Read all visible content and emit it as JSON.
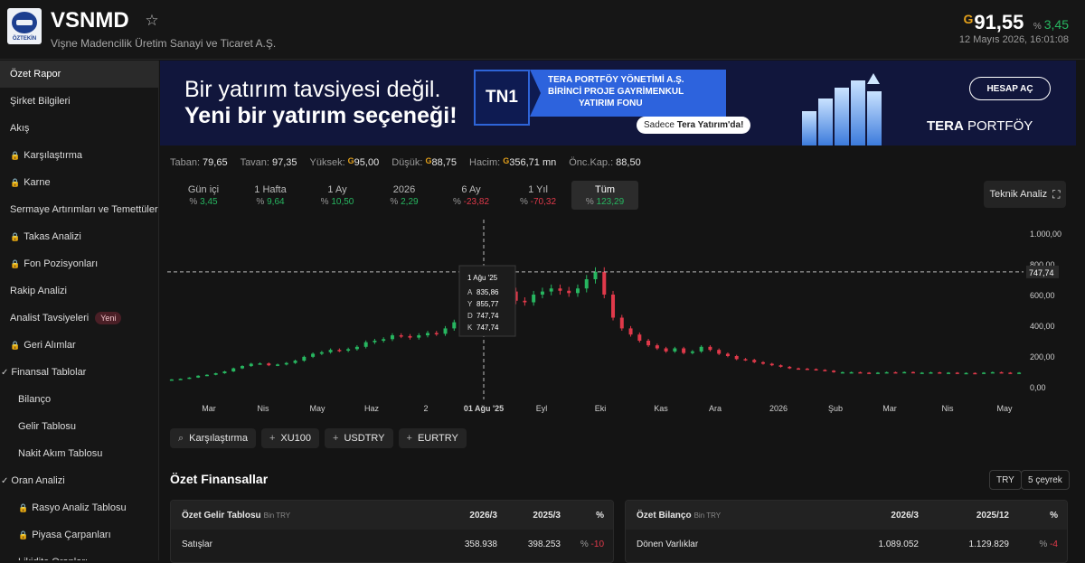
{
  "header": {
    "logo_text": "ÖZTEKİN",
    "ticker": "VSNMD",
    "company": "Vişne Madencilik Üretim Sanayi ve Ticaret A.Ş.",
    "currency_symbol": "G",
    "price": "91,55",
    "change_pct_symbol": "%",
    "change": "3,45",
    "timestamp": "12 Mayıs 2026, 16:01:08"
  },
  "sidebar": {
    "items": [
      {
        "label": "Özet Rapor",
        "lock": false,
        "active": true
      },
      {
        "label": "Şirket Bilgileri",
        "lock": false
      },
      {
        "label": "Akış",
        "lock": false
      },
      {
        "label": "Karşılaştırma",
        "lock": true
      },
      {
        "label": "Karne",
        "lock": true
      },
      {
        "label": "Sermaye Artırımları ve Temettüler",
        "lock": false
      },
      {
        "label": "Takas Analizi",
        "lock": true
      },
      {
        "label": "Fon Pozisyonları",
        "lock": true
      },
      {
        "label": "Rakip Analizi",
        "lock": false
      },
      {
        "label": "Analist Tavsiyeleri",
        "lock": false,
        "badge": "Yeni"
      },
      {
        "label": "Geri Alımlar",
        "lock": true
      },
      {
        "label": "Finansal Tablolar",
        "lock": false,
        "expanded": true
      },
      {
        "label": "Bilanço",
        "sub": true
      },
      {
        "label": "Gelir Tablosu",
        "sub": true
      },
      {
        "label": "Nakit Akım Tablosu",
        "sub": true
      },
      {
        "label": "Oran Analizi",
        "lock": false,
        "expanded": true
      },
      {
        "label": "Rasyo Analiz Tablosu",
        "sub": true,
        "lock": true
      },
      {
        "label": "Piyasa Çarpanları",
        "sub": true,
        "lock": true
      },
      {
        "label": "Likidite Oranları",
        "sub": true
      }
    ]
  },
  "banner": {
    "line1": "Bir yatırım tavsiyesi değil.",
    "line2": "Yeni bir yatırım seçeneği!",
    "fund_code": "TN1",
    "fund_name_1": "TERA PORTFÖY YÖNETİMİ A.Ş.",
    "fund_name_2": "BİRİNCİ PROJE GAYRİMENKUL",
    "fund_name_3": "YATIRIM FONU",
    "pill_pre": "Sadece ",
    "pill_bold": "Tera Yatırım'da!",
    "cta": "HESAP AÇ",
    "brand_bold": "TERA",
    "brand_rest": " PORTFÖY"
  },
  "stats": [
    {
      "label": "Taban:",
      "value": "79,65",
      "g": false
    },
    {
      "label": "Tavan:",
      "value": "97,35",
      "g": false
    },
    {
      "label": "Yüksek:",
      "value": "95,00",
      "g": true
    },
    {
      "label": "Düşük:",
      "value": "88,75",
      "g": true
    },
    {
      "label": "Hacim:",
      "value": "356,71 mn",
      "g": true
    },
    {
      "label": "Önc.Kap.:",
      "value": "88,50",
      "g": false
    }
  ],
  "periods": [
    {
      "label": "Gün içi",
      "value": "3,45",
      "sign": "pos"
    },
    {
      "label": "1 Hafta",
      "value": "9,64",
      "sign": "pos"
    },
    {
      "label": "1 Ay",
      "value": "10,50",
      "sign": "pos"
    },
    {
      "label": "2026",
      "value": "2,29",
      "sign": "pos"
    },
    {
      "label": "6 Ay",
      "value": "-23,82",
      "sign": "neg"
    },
    {
      "label": "1 Yıl",
      "value": "-70,32",
      "sign": "neg"
    },
    {
      "label": "Tüm",
      "value": "123,29",
      "sign": "pos",
      "active": true
    }
  ],
  "teknik_label": "Teknik Analiz",
  "chart_data": {
    "type": "line",
    "x_ticks": [
      "Mar",
      "Nis",
      "May",
      "Haz",
      "2",
      "01 Ağu '25",
      "Eyl",
      "Eki",
      "Kas",
      "Ara",
      "2026",
      "Şub",
      "Mar",
      "Nis",
      "May"
    ],
    "y_ticks": [
      "1.000,00",
      "800,00",
      "600,00",
      "400,00",
      "200,00",
      "0,00"
    ],
    "ylim": [
      0,
      1000
    ],
    "crosshair_value": "747,74",
    "tooltip": {
      "date": "1 Ağu '25",
      "A": "835,86",
      "Y": "855,77",
      "D": "747,74",
      "K": "747,74"
    },
    "close_series": [
      48,
      52,
      60,
      72,
      78,
      88,
      100,
      120,
      135,
      150,
      152,
      140,
      145,
      155,
      170,
      195,
      215,
      225,
      240,
      235,
      245,
      260,
      290,
      300,
      310,
      335,
      330,
      320,
      335,
      350,
      345,
      380,
      420,
      440,
      480,
      500,
      560,
      600,
      620,
      560,
      550,
      600,
      620,
      640,
      625,
      610,
      640,
      700,
      748,
      600,
      450,
      380,
      340,
      300,
      270,
      250,
      230,
      250,
      220,
      230,
      260,
      240,
      215,
      200,
      180,
      175,
      160,
      150,
      140,
      130,
      120,
      118,
      115,
      110,
      105,
      95,
      95,
      95,
      92,
      90,
      92,
      95,
      94,
      96,
      92,
      92,
      94,
      92,
      92,
      90,
      90,
      88,
      92,
      95,
      92,
      90,
      92
    ]
  },
  "compare": [
    "Karşılaştırma",
    "XU100",
    "USDTRY",
    "EURTRY"
  ],
  "ozet": {
    "title": "Özet Finansallar",
    "currency": "TRY",
    "period": "5 çeyrek",
    "income": {
      "title": "Özet Gelir Tablosu",
      "unit": "Bin TRY",
      "cols": [
        "2026/3",
        "2025/3",
        "%"
      ],
      "row_label": "Satışlar",
      "v1": "358.938",
      "v2": "398.253",
      "pct_sym": "%",
      "pct": "-10"
    },
    "balance": {
      "title": "Özet Bilanço",
      "unit": "Bin TRY",
      "cols": [
        "2026/3",
        "2025/12",
        "%"
      ],
      "row_label": "Dönen Varlıklar",
      "v1": "1.089.052",
      "v2": "1.129.829",
      "pct_sym": "%",
      "pct": "-4"
    }
  }
}
